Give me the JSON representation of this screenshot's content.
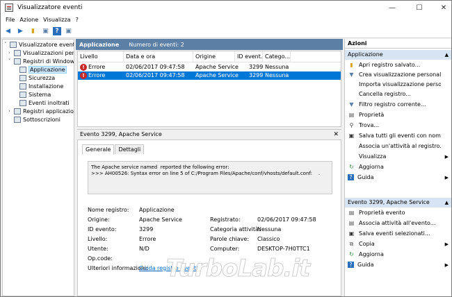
{
  "window": {
    "title": "Visualizzatore eventi"
  },
  "menu": [
    "File",
    "Azione",
    "Visualizza",
    "?"
  ],
  "tree": {
    "root": "Visualizzatore eventi (cor",
    "custom_views": "Visualizzazioni person",
    "windows_logs": "Registri di Windows",
    "logs": [
      "Applicazione",
      "Sicurezza",
      "Installazione",
      "Sistema",
      "Eventi inoltrati"
    ],
    "app_services": "Registri applicazioni e",
    "subscriptions": "Sottoscrizioni"
  },
  "list": {
    "header_title": "Applicazione",
    "header_count": "Numero di eventi: 2",
    "columns": [
      "Livello",
      "Data e ora",
      "Origine",
      "ID event...",
      "Catego..."
    ],
    "rows": [
      {
        "level": "Errore",
        "date": "02/06/2017 09:47:58",
        "source": "Apache Service",
        "id": "3299",
        "category": "Nessuna"
      },
      {
        "level": "Errore",
        "date": "02/06/2017 09:47:58",
        "source": "Apache Service",
        "id": "3299",
        "category": "Nessuna"
      }
    ]
  },
  "detail": {
    "title": "Evento 3299, Apache Service",
    "tabs": [
      "Generale",
      "Dettagli"
    ],
    "message": "The Apache service named  reported the following error:\n>>> AH00526: Syntax error on line 5 of C:/Program Files/Apache/conf/vhosts/default.conf:    .",
    "fields": {
      "log_name_label": "Nome registro:",
      "log_name": "Applicazione",
      "source_label": "Origine:",
      "source": "Apache Service",
      "logged_label": "Registrato:",
      "logged": "02/06/2017 09:47:58",
      "event_id_label": "ID evento:",
      "event_id": "3299",
      "task_label": "Categoria attività:",
      "task": "Nessuna",
      "level_label": "Livello:",
      "level": "Errore",
      "keywords_label": "Parole chiave:",
      "keywords": "Classico",
      "user_label": "Utente:",
      "user": "N/D",
      "computer_label": "Computer:",
      "computer": "DESKTOP-7H0TTC1",
      "opcode_label": "Op.code:",
      "opcode": "",
      "moreinfo_label": "Ulteriori informazioni:",
      "moreinfo_link": "Guida registro eventi"
    }
  },
  "actions": {
    "title": "Azioni",
    "section1": "Applicazione",
    "items1": [
      "Apri registro salvato...",
      "Crea visualizzazione personalizz...",
      "Importa visualizzazione persona...",
      "Cancella registro...",
      "Filtro registro corrente...",
      "Proprietà",
      "Trova...",
      "Salva tutti gli eventi con nome...",
      "Associa un'attività al registro...",
      "Visualizza",
      "Aggiorna",
      "Guida"
    ],
    "section2": "Evento 3299, Apache Service",
    "items2": [
      "Proprietà evento",
      "Associa attività all'evento...",
      "Salva eventi selezionati...",
      "Copia",
      "Aggiorna",
      "Guida"
    ]
  },
  "watermark": "TurboLab.it"
}
